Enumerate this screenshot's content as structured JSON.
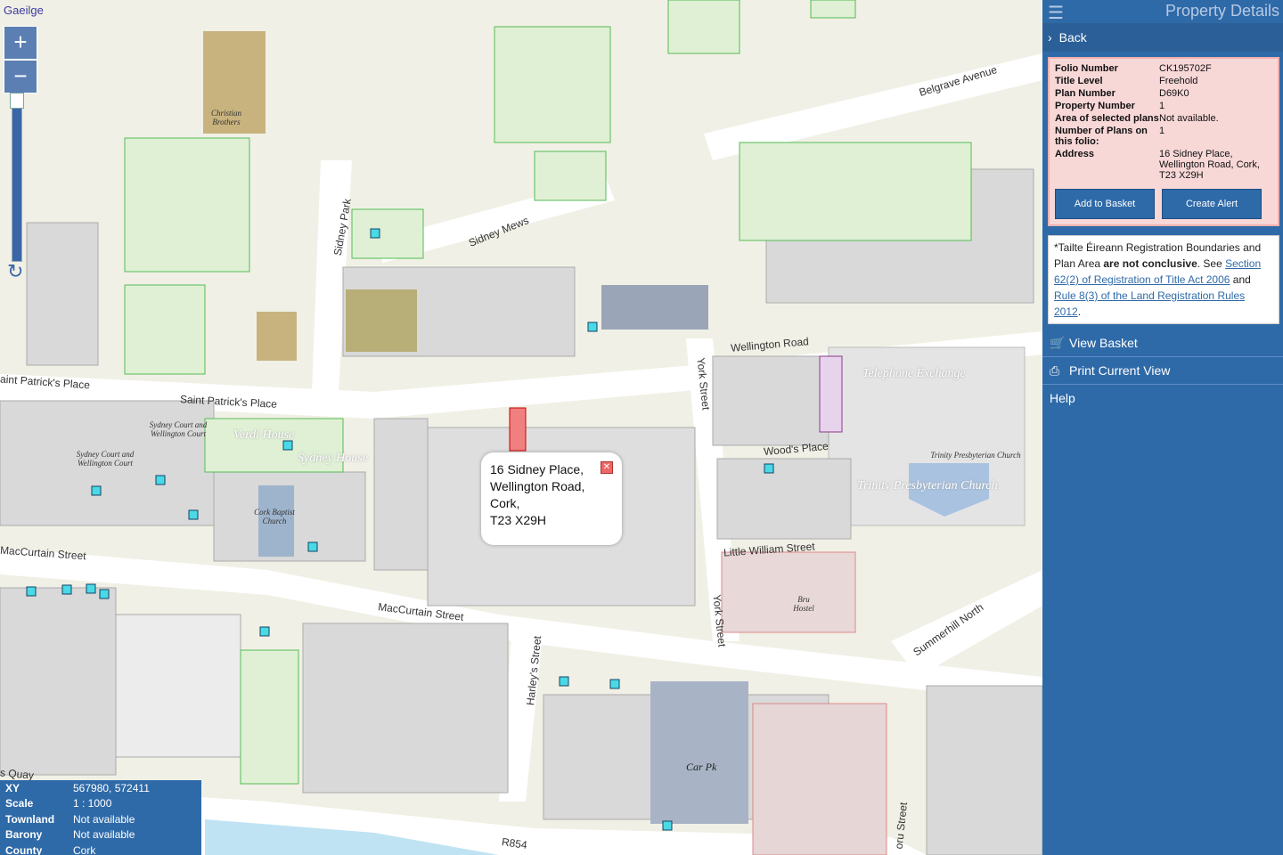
{
  "map": {
    "language_link": "Gaeilge",
    "zoom_in": "+",
    "zoom_out": "−",
    "streets": {
      "belgrave": "Belgrave Avenue",
      "sidney_park": "Sidney Park",
      "sidney_mews": "Sidney Mews",
      "wellington": "Wellington Road",
      "saint_patricks_1": "aint Patrick's Place",
      "saint_patricks_2": "Saint Patrick's Place",
      "york_1": "York Street",
      "york_2": "York Street",
      "woods": "Wood's Place",
      "little_william": "Little William Street",
      "maccurtain_1": "MacCurtain Street",
      "maccurtain_2": "MacCurtain Street",
      "harleys": "Harley's Street",
      "summerhill": "Summerhill North",
      "r854": "R854",
      "quay": "s Quay",
      "street_bottom_right": "oru Street"
    },
    "places": {
      "telephone": "Telephone Exchange",
      "trinity": "Trinity Presbyterian Church",
      "verdi": "Verdi House",
      "sydney_house": "Sydney House",
      "car_pk": "Car Pk"
    },
    "small_places": {
      "christian": "Christian Brothers",
      "sydney_court_1": "Sydney Court and Wellington Court",
      "sydney_court_2": "Sydney Court and Wellington Court",
      "cork_baptist": "Cork Baptist Church",
      "trinity_small": "Trinity Presbyterian Church",
      "bru": "Bru Hostel"
    },
    "popup": {
      "line1": "16 Sidney Place,",
      "line2": "Wellington Road,",
      "line3": "Cork,",
      "line4": "T23 X29H"
    },
    "info": {
      "xy_label": "XY",
      "xy_value": "567980, 572411",
      "scale_label": "Scale",
      "scale_value": "1 : 1000",
      "townland_label": "Townland",
      "townland_value": "Not available",
      "barony_label": "Barony",
      "barony_value": "Not available",
      "county_label": "County",
      "county_value": "Cork"
    }
  },
  "panel": {
    "title": "Property Details",
    "back": "Back",
    "details": [
      {
        "key": "Folio Number",
        "value": "CK195702F"
      },
      {
        "key": "Title Level",
        "value": "Freehold"
      },
      {
        "key": "Plan Number",
        "value": "D69K0"
      },
      {
        "key": "Property Number",
        "value": "1"
      },
      {
        "key": "Area of selected plans",
        "value": "Not available."
      },
      {
        "key": "Number of Plans on this folio:",
        "value": "1"
      },
      {
        "key": "Address",
        "value": "16 Sidney Place, Wellington Road, Cork, T23 X29H"
      }
    ],
    "add_basket": "Add to Basket",
    "create_alert": "Create Alert",
    "notice": {
      "part1": "*Tailte Éireann Registration Boundaries and Plan Area ",
      "bold": "are not conclusive",
      "part2": ". See ",
      "link1": "Section 62(2) of Registration of Title Act 2006",
      "and": " and ",
      "link2": "Rule 8(3) of the Land Registration Rules 2012",
      "end": "."
    },
    "menu": {
      "view_basket": "View Basket",
      "print": "Print Current View",
      "help": "Help"
    }
  }
}
